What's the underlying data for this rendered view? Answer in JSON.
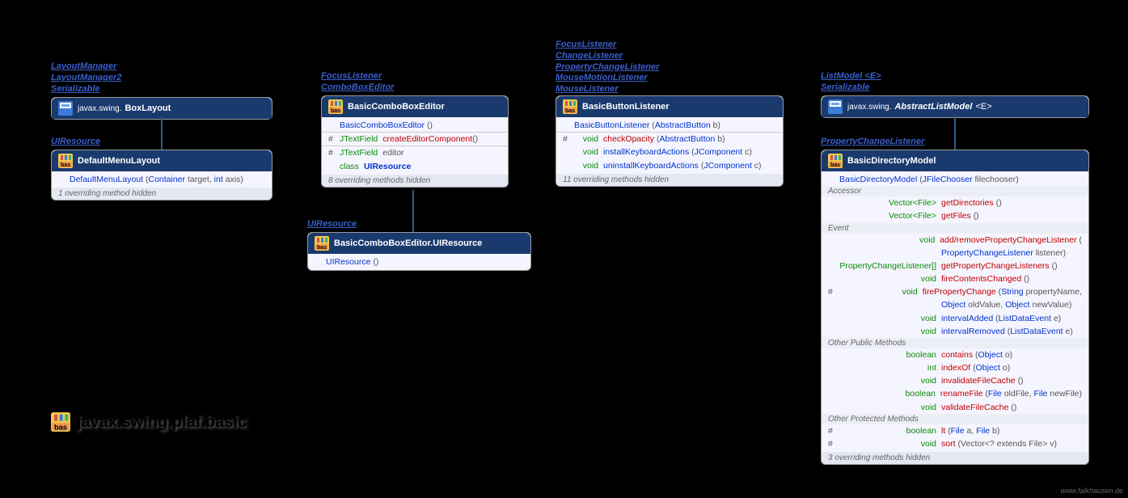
{
  "package_label": "javax.swing.plaf.basic",
  "footer_url": "www.falkhausen.de",
  "boxes": {
    "box1": {
      "implements": [
        "LayoutManager",
        "LayoutManager2",
        "Serializable"
      ],
      "pkg": "javax.swing.",
      "name": "BoxLayout",
      "icon": "java"
    },
    "box2": {
      "implements": [
        "UIResource"
      ],
      "name": "DefaultMenuLayout",
      "icon": "bas",
      "constructor": "DefaultMenuLayout",
      "ctor_params": [
        [
          "Container",
          "target"
        ],
        [
          "int",
          "axis"
        ]
      ],
      "overrides": "1 overriding method hidden"
    },
    "box3": {
      "implements": [
        "FocusListener",
        "ComboBoxEditor"
      ],
      "name": "BasicComboBoxEditor",
      "icon": "bas",
      "constructor": "BasicComboBoxEditor",
      "m1_vis": "#",
      "m1_ret": "JTextField",
      "m1_name": "createEditorComponent",
      "m1_params": "()",
      "f1_vis": "#",
      "f1_ret": "JTextField",
      "f1_name": "editor",
      "inner_ret": "class",
      "inner_name": "UIResource",
      "overrides": "8 overriding methods hidden"
    },
    "box4": {
      "implements": [
        "UIResource"
      ],
      "name": "BasicComboBoxEditor.UIResource",
      "icon": "bas",
      "constructor": "UIResource"
    },
    "box5": {
      "implements": [
        "FocusListener",
        "ChangeListener",
        "PropertyChangeListener",
        "MouseMotionListener",
        "MouseListener"
      ],
      "name": "BasicButtonListener",
      "icon": "bas",
      "constructor": "BasicButtonListener",
      "ctor_params": [
        [
          "AbstractButton",
          "b"
        ]
      ],
      "m1_vis": "#",
      "m1_ret": "void",
      "m1_name": "checkOpacity",
      "m1_p": [
        [
          "AbstractButton",
          "b"
        ]
      ],
      "m2_ret": "void",
      "m2_name": "installKeyboardActions",
      "m2_p": [
        [
          "JComponent",
          "c"
        ]
      ],
      "m3_ret": "void",
      "m3_name": "uninstallKeyboardActions",
      "m3_p": [
        [
          "JComponent",
          "c"
        ]
      ],
      "overrides": "11 overriding methods hidden"
    },
    "box6": {
      "implements": [
        "ListModel <E>",
        "Serializable"
      ],
      "pkg": "javax.swing.",
      "name": "AbstractListModel",
      "typevar": "<E>",
      "icon": "java"
    },
    "box7": {
      "implements": [
        "PropertyChangeListener"
      ],
      "name": "BasicDirectoryModel",
      "icon": "bas",
      "constructor": "BasicDirectoryModel",
      "ctor_params": [
        [
          "JFileChooser",
          "filechooser"
        ]
      ],
      "sec_accessor": "Accessor",
      "a1_ret": "Vector<File>",
      "a1_name": "getDirectories",
      "a1_p": "()",
      "a2_ret": "Vector<File>",
      "a2_name": "getFiles",
      "a2_p": "()",
      "sec_event": "Event",
      "e1_ret": "void",
      "e1_name": "add/removePropertyChangeListener",
      "e1_cont": "PropertyChangeListener listener)",
      "e2_ret": "PropertyChangeListener[]",
      "e2_name": "getPropertyChangeListeners",
      "e2_p": "()",
      "e3_ret": "void",
      "e3_name": "fireContentsChanged",
      "e3_p": "()",
      "e4_vis": "#",
      "e4_ret": "void",
      "e4_name": "firePropertyChange",
      "e4_cont": "Object oldValue, Object newValue)",
      "e4_p": [
        [
          "String",
          "propertyName"
        ]
      ],
      "e5_ret": "void",
      "e5_name": "intervalAdded",
      "e5_p": [
        [
          "ListDataEvent",
          "e"
        ]
      ],
      "e6_ret": "void",
      "e6_name": "intervalRemoved",
      "e6_p": [
        [
          "ListDataEvent",
          "e"
        ]
      ],
      "sec_pub": "Other Public Methods",
      "p1_ret": "boolean",
      "p1_name": "contains",
      "p1_p": [
        [
          "Object",
          "o"
        ]
      ],
      "p2_ret": "int",
      "p2_name": "indexOf",
      "p2_p": [
        [
          "Object",
          "o"
        ]
      ],
      "p3_ret": "void",
      "p3_name": "invalidateFileCache",
      "p3_p": "()",
      "p4_ret": "boolean",
      "p4_name": "renameFile",
      "p4_p": [
        [
          "File",
          "oldFile"
        ],
        [
          "File",
          "newFile"
        ]
      ],
      "p5_ret": "void",
      "p5_name": "validateFileCache",
      "p5_p": "()",
      "sec_prot": "Other Protected Methods",
      "q1_vis": "#",
      "q1_ret": "boolean",
      "q1_name": "lt",
      "q1_p": [
        [
          "File",
          "a"
        ],
        [
          "File",
          "b"
        ]
      ],
      "q2_vis": "#",
      "q2_ret": "void",
      "q2_name": "sort",
      "q2_p_raw": "(Vector<? extends File> v)",
      "overrides": "3 overriding methods hidden"
    }
  }
}
